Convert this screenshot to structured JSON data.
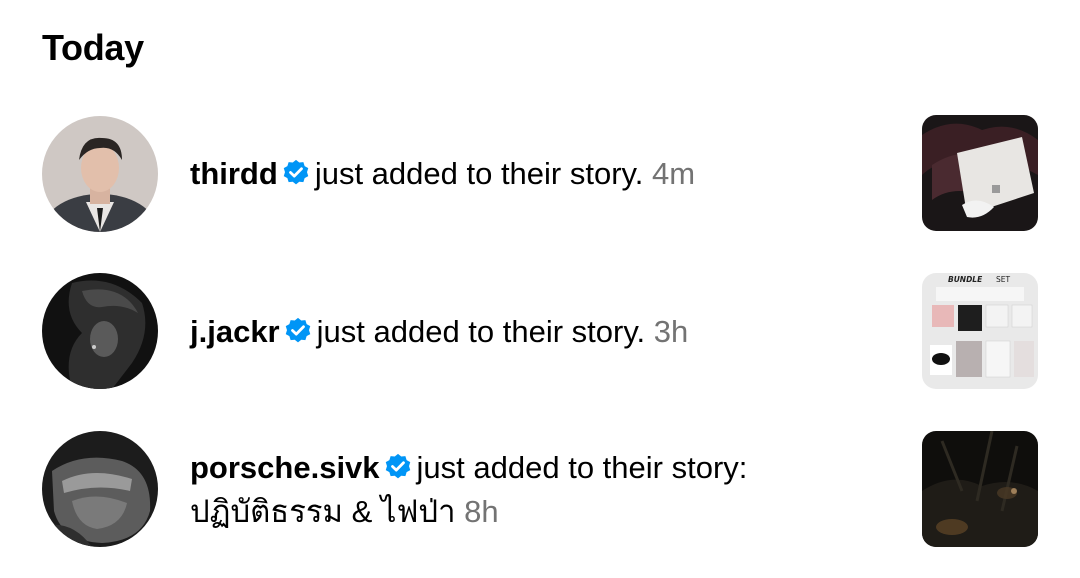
{
  "section": {
    "title": "Today"
  },
  "colors": {
    "verified_badge": "#0095f6",
    "timestamp": "#737373",
    "text": "#000000"
  },
  "notifications": [
    {
      "username": "thirdd",
      "verified": true,
      "message": "just added to their story.",
      "time": "4m",
      "avatar_icon": "profile-photo",
      "thumbnail_icon": "story-thumbnail"
    },
    {
      "username": "j.jackr",
      "verified": true,
      "message": "just added to their story.",
      "time": "3h",
      "avatar_icon": "profile-photo",
      "thumbnail_icon": "story-thumbnail",
      "thumbnail_text": {
        "left": "BUNDLE",
        "right": "SET"
      }
    },
    {
      "username": "porsche.sivk",
      "verified": true,
      "message": "just added to their story:",
      "caption": "ปฏิบัติธรรม & ไฟป่า",
      "time": "8h",
      "avatar_icon": "profile-photo",
      "thumbnail_icon": "story-thumbnail"
    }
  ]
}
